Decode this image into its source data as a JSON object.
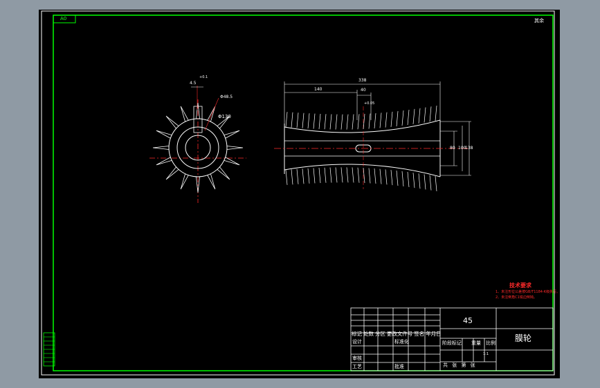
{
  "drawing": {
    "sheet_code": "A0",
    "roughness_note": "其余",
    "dims": {
      "tooth_small": "4.5",
      "keyway_tol": "+0.1",
      "bore_note": "Φ48.5",
      "od": "Φ130",
      "length": "338",
      "left_len": "140",
      "mid_len": "40",
      "d1": "80",
      "d2": "100",
      "d3": "138",
      "hole_tol": "+0.05"
    },
    "tech_req": {
      "title": "技术要求",
      "line1": "1、未注形位公差按GB/T1184-K级执行。",
      "line2": "2、未注倒角C1锐边倒钝。"
    }
  },
  "title_block": {
    "material": "45",
    "part_name": "膜轮",
    "header_row": "标记 处数 分区 更改文件号 签名 年月日",
    "design": "设计",
    "standardize": "标准化",
    "stage_mark": "阶段标记",
    "weight": "重量",
    "scale_label": "比例",
    "scale_value": "1:1",
    "sheets": "共  张 第  张",
    "review": "审核",
    "process": "工艺",
    "approve": "批准"
  },
  "colors": {
    "sheet": "#000000",
    "frame": "#00ff00",
    "lines": "#ffffff",
    "center": "#ff2a2a"
  }
}
